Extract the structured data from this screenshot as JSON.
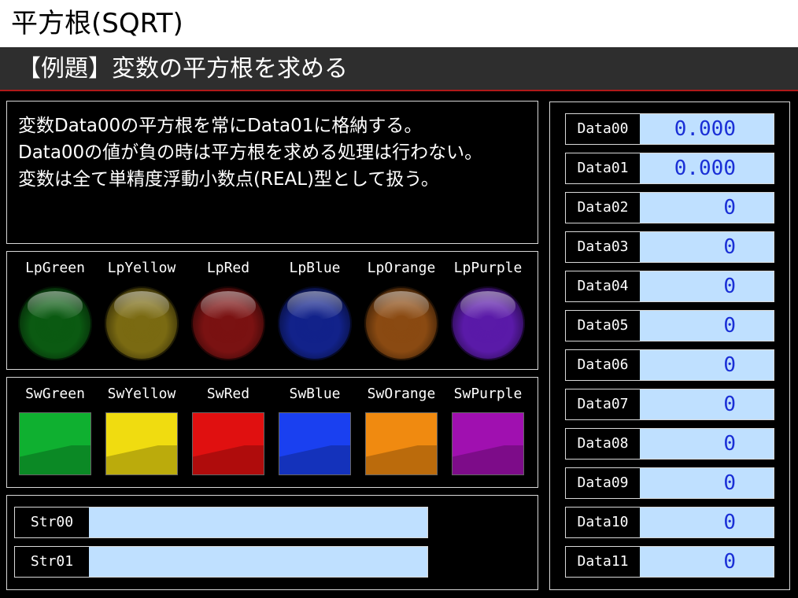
{
  "title": "平方根(SQRT)",
  "subtitle": "【例題】変数の平方根を求める",
  "description": [
    "変数Data00の平方根を常にData01に格納する。",
    "Data00の値が負の時は平方根を求める処理は行わない。",
    "変数は全て単精度浮動小数点(REAL)型として扱う。"
  ],
  "lamps": [
    {
      "label": "LpGreen",
      "color": "#0b5a12"
    },
    {
      "label": "LpYellow",
      "color": "#7a6a12"
    },
    {
      "label": "LpRed",
      "color": "#7a1212"
    },
    {
      "label": "LpBlue",
      "color": "#12228a"
    },
    {
      "label": "LpOrange",
      "color": "#8a4a12"
    },
    {
      "label": "LpPurple",
      "color": "#5a1aa8"
    }
  ],
  "switches": [
    {
      "label": "SwGreen",
      "color": "#0fb030"
    },
    {
      "label": "SwYellow",
      "color": "#f0dc10"
    },
    {
      "label": "SwRed",
      "color": "#e01010"
    },
    {
      "label": "SwBlue",
      "color": "#1a40f0"
    },
    {
      "label": "SwOrange",
      "color": "#f08a10"
    },
    {
      "label": "SwPurple",
      "color": "#a010b0"
    }
  ],
  "strings": [
    {
      "name": "Str00",
      "value": ""
    },
    {
      "name": "Str01",
      "value": ""
    }
  ],
  "data": [
    {
      "name": "Data00",
      "value": "0.000"
    },
    {
      "name": "Data01",
      "value": "0.000"
    },
    {
      "name": "Data02",
      "value": "0"
    },
    {
      "name": "Data03",
      "value": "0"
    },
    {
      "name": "Data04",
      "value": "0"
    },
    {
      "name": "Data05",
      "value": "0"
    },
    {
      "name": "Data06",
      "value": "0"
    },
    {
      "name": "Data07",
      "value": "0"
    },
    {
      "name": "Data08",
      "value": "0"
    },
    {
      "name": "Data09",
      "value": "0"
    },
    {
      "name": "Data10",
      "value": "0"
    },
    {
      "name": "Data11",
      "value": "0"
    }
  ]
}
